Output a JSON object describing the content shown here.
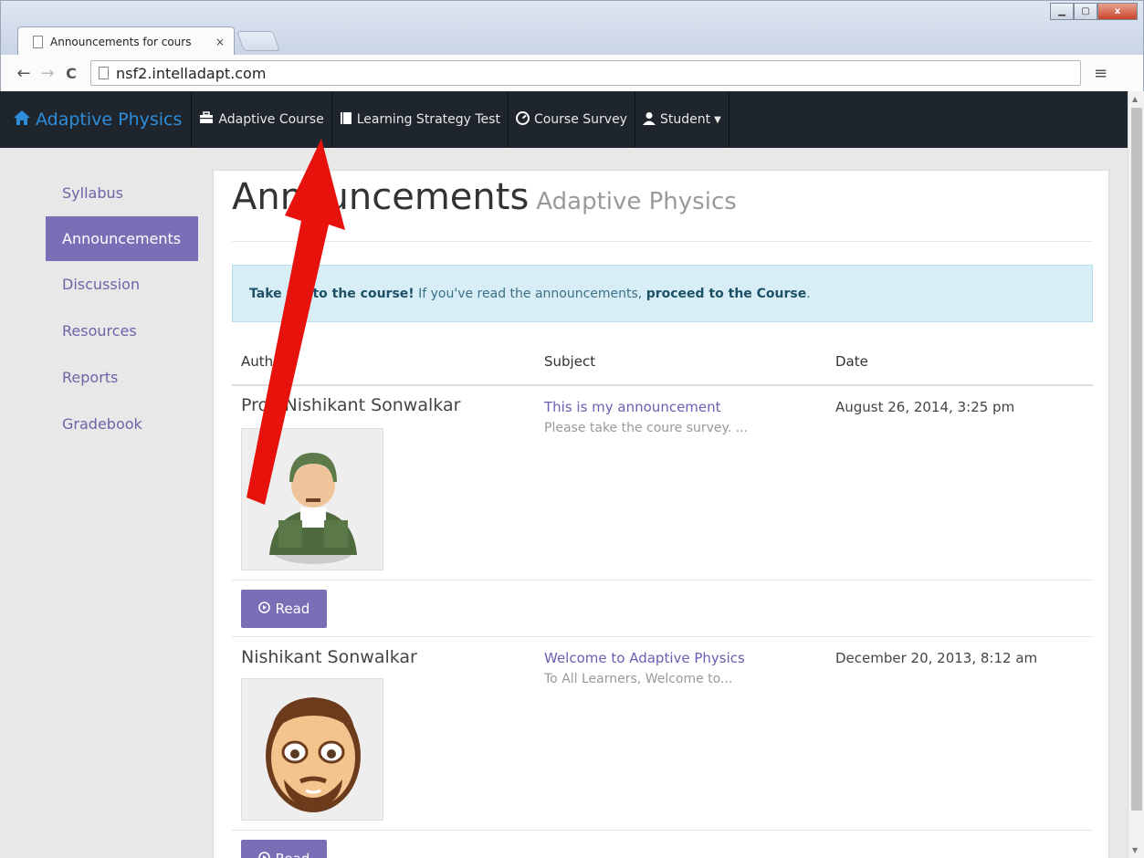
{
  "browser": {
    "tab_title": "Announcements for cours",
    "tab_close": "×",
    "url": "nsf2.intelladapt.com",
    "back": "←",
    "forward": "→",
    "reload": "C",
    "menu": "≡",
    "minimize": "▁",
    "maximize": "▢",
    "close": "x"
  },
  "navbar": {
    "brand": "Adaptive Physics",
    "brand_icon": "home-icon",
    "items": [
      {
        "label": "Adaptive Course",
        "icon": "briefcase-icon"
      },
      {
        "label": "Learning Strategy Test",
        "icon": "book-icon"
      },
      {
        "label": "Course Survey",
        "icon": "dashboard-icon"
      },
      {
        "label": "Student",
        "icon": "user-icon",
        "caret": "▼"
      }
    ]
  },
  "sidebar": {
    "items": [
      {
        "label": "Syllabus",
        "active": false
      },
      {
        "label": "Announcements",
        "active": true
      },
      {
        "label": "Discussion",
        "active": false
      },
      {
        "label": "Resources",
        "active": false
      },
      {
        "label": "Reports",
        "active": false
      },
      {
        "label": "Gradebook",
        "active": false
      }
    ]
  },
  "main": {
    "title": "Announcements",
    "subtitle": "Adaptive Physics",
    "alert": {
      "lead": "Take me to the course!",
      "middle": " If you've read the announcements, ",
      "link": "proceed to the Course",
      "tail": "."
    },
    "columns": [
      "Author",
      "Subject",
      "Date"
    ],
    "rows": [
      {
        "author": "Prof. Nishikant Sonwalkar",
        "avatar": "soldier-avatar",
        "subject": "This is my announcement",
        "preview": "Please take the coure survey. ...",
        "date": "August 26, 2014, 3:25 pm",
        "action": "Read"
      },
      {
        "author": "Nishikant Sonwalkar",
        "avatar": "bearded-man-avatar",
        "subject": "Welcome to Adaptive Physics",
        "preview": "To All Learners, Welcome to...",
        "date": "December 20, 2013, 8:12 am",
        "action": "Read"
      }
    ]
  },
  "colors": {
    "navbar_bg": "#1f252c",
    "brand": "#2e8ddb",
    "accent": "#7a6fb6",
    "alert_bg": "#d8eef6",
    "annotation_arrow": "#e8120c"
  }
}
